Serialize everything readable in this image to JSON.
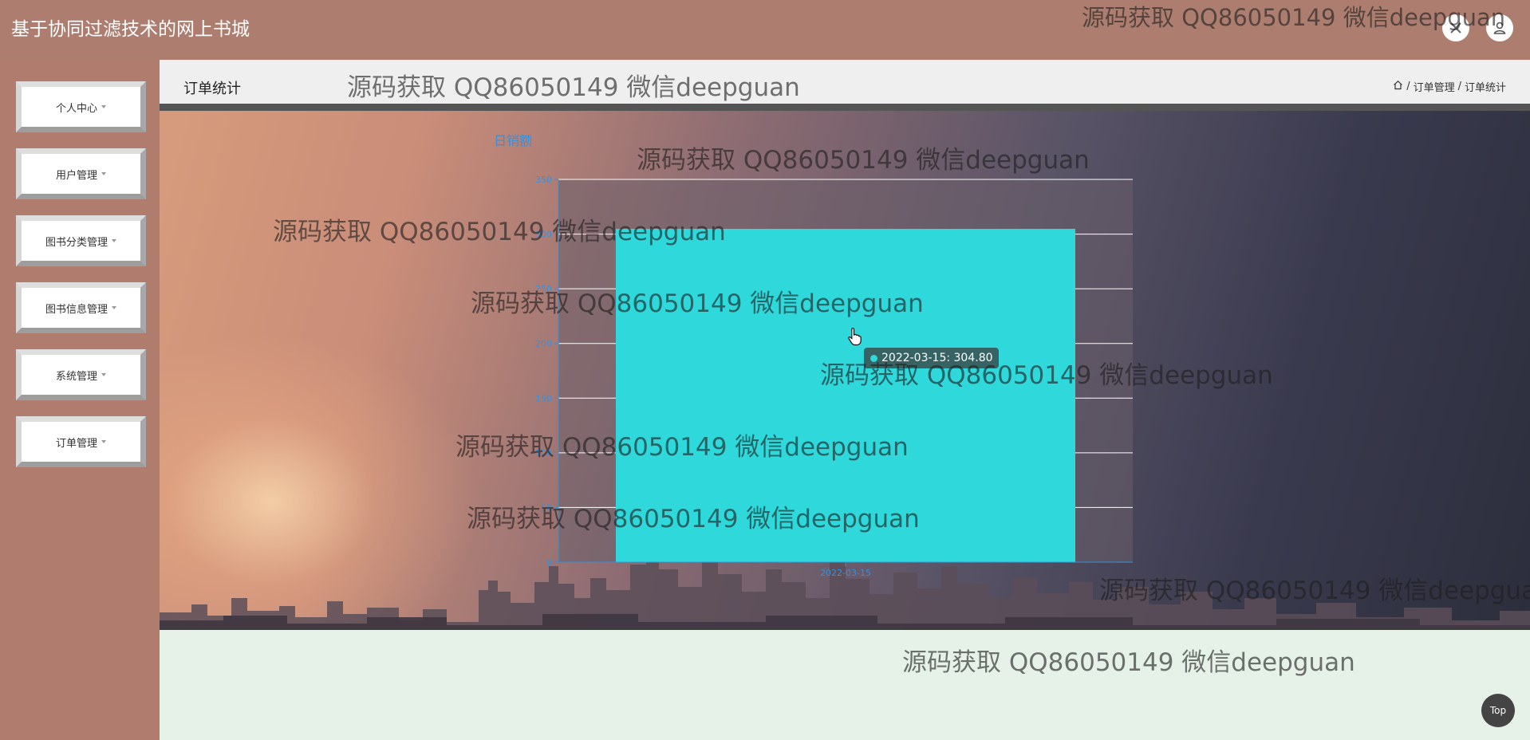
{
  "app": {
    "title": "基于协同过滤技术的网上书城"
  },
  "header_icons": [
    "close-icon",
    "user-icon"
  ],
  "sidebar": {
    "items": [
      {
        "label": "个人中心"
      },
      {
        "label": "用户管理"
      },
      {
        "label": "图书分类管理"
      },
      {
        "label": "图书信息管理"
      },
      {
        "label": "系统管理"
      },
      {
        "label": "订单管理"
      }
    ]
  },
  "page": {
    "title": "订单统计",
    "breadcrumb": {
      "separator": "/",
      "items": [
        "订单管理",
        "订单统计"
      ]
    }
  },
  "chart_data": {
    "type": "bar",
    "title": "",
    "ylabel": "日销额",
    "xlabel": "",
    "categories": [
      "2022-03-15"
    ],
    "values": [
      304.8
    ],
    "yticks": [
      0,
      50,
      100,
      150,
      200,
      250,
      300,
      350
    ],
    "ylim": [
      0,
      350
    ],
    "grid": true,
    "bar_color": "#2fd8db",
    "axis_color": "#3b8fd6"
  },
  "tooltip": {
    "text": "2022-03-15: 304.80"
  },
  "top_button": {
    "label": "Top"
  },
  "watermark": {
    "text": "源码获取 QQ86050149 微信deepguan"
  }
}
